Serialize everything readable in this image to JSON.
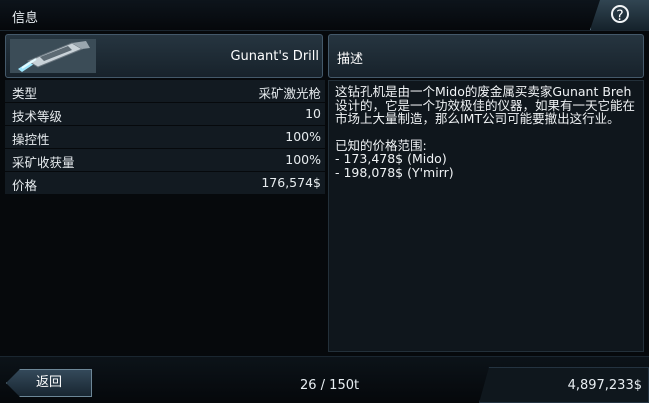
{
  "header": {
    "title": "信息",
    "help_icon": "question-mark-icon"
  },
  "item": {
    "name": "Gunant's Drill",
    "icon": "mining-laser-icon",
    "stats": [
      {
        "label": "类型",
        "value": "采矿激光枪"
      },
      {
        "label": "技术等级",
        "value": "10"
      },
      {
        "label": "操控性",
        "value": "100%"
      },
      {
        "label": "采矿收获量",
        "value": "100%"
      },
      {
        "label": "价格",
        "value": "176,574$"
      }
    ]
  },
  "description": {
    "title": "描述",
    "text": "这钻孔机是由一个Mido的废金属买卖家Gunant Breh设计的，它是一个功效极佳的仪器，如果有一天它能在市场上大量制造，那么IMT公司可能要撤出这行业。",
    "price_heading": "已知的价格范围:",
    "prices": [
      "- 173,478$ (Mido)",
      "- 198,078$ (Y'mirr)"
    ]
  },
  "footer": {
    "back_label": "返回",
    "cargo": "26 / 150t",
    "money": "4,897,233$"
  }
}
